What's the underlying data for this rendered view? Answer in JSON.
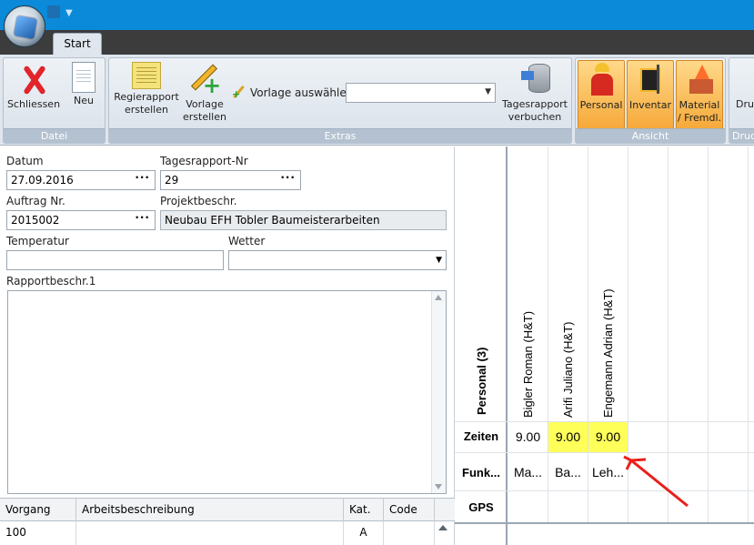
{
  "ribbon": {
    "tab": "Start",
    "groups": {
      "datei": "Datei",
      "extras": "Extras",
      "ansicht": "Ansicht",
      "druck": "Druc"
    },
    "buttons": {
      "schliessen": "Schliessen",
      "neu": "Neu",
      "regierapport_1": "Regierapport",
      "regierapport_2": "erstellen",
      "vorlage_1": "Vorlage",
      "vorlage_2": "erstellen",
      "tages_1": "Tagesrapport",
      "tages_2": "verbuchen",
      "personal": "Personal",
      "inventar": "Inventar",
      "material_1": "Material",
      "material_2": "/ Fremdl.",
      "druck": "Druc"
    },
    "vorlage_label": "Vorlage auswählen",
    "vorlage_value": ""
  },
  "form": {
    "datum_label": "Datum",
    "datum_value": "27.09.2016",
    "tagesrapport_label": "Tagesrapport-Nr",
    "tagesrapport_value": "29",
    "auftrag_label": "Auftrag Nr.",
    "auftrag_value": "2015002",
    "projekt_label": "Projektbeschr.",
    "projekt_value": "Neubau EFH Tobler Baumeisterarbeiten",
    "temperatur_label": "Temperatur",
    "temperatur_value": "",
    "wetter_label": "Wetter",
    "wetter_value": "",
    "rapport_label": "Rapportbeschr.1",
    "rapport_value": "",
    "dots": "···"
  },
  "grid": {
    "columns": [
      "Vorgang",
      "Arbeitsbeschreibung",
      "Kat.",
      "Code"
    ],
    "rows": [
      {
        "vorgang": "100",
        "beschreibung": "",
        "kat": "A",
        "code": ""
      }
    ]
  },
  "personal": {
    "header": "Personal (3)",
    "row_labels": {
      "zeiten": "Zeiten",
      "funktion": "Funk...",
      "gps": "GPS"
    },
    "people": [
      {
        "name": "Bigler Roman (H&T)",
        "zeit": "9.00",
        "funktion": "Ma...",
        "highlight": false
      },
      {
        "name": "Arifi Juliano (H&T)",
        "zeit": "9.00",
        "funktion": "Ba...",
        "highlight": true
      },
      {
        "name": "Engemann Adrian (H&T)",
        "zeit": "9.00",
        "funktion": "Leh...",
        "highlight": true
      }
    ],
    "highlight_color": "#ffff5a",
    "annotation_color": "#e8201c"
  }
}
